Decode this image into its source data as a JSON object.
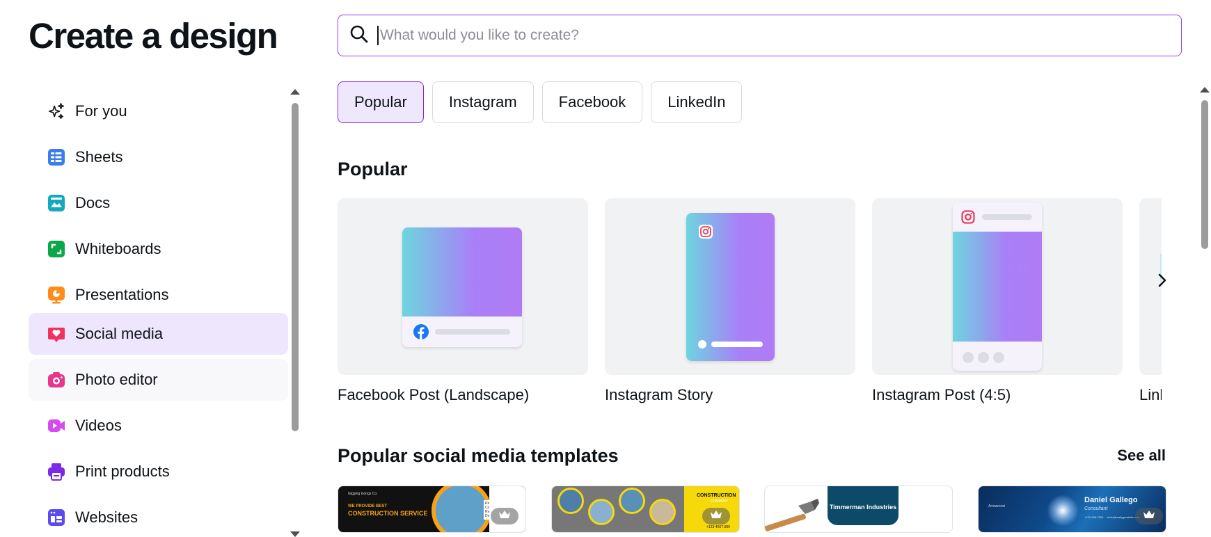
{
  "page": {
    "title": "Create a design"
  },
  "search": {
    "placeholder": "What would you like to create?"
  },
  "sidebar": {
    "items": [
      {
        "label": "For you",
        "icon": "sparkles-icon",
        "color": "#0e1318"
      },
      {
        "label": "Sheets",
        "icon": "sheets-icon",
        "color": "#3b7de9"
      },
      {
        "label": "Docs",
        "icon": "docs-icon",
        "color": "#13a9c1"
      },
      {
        "label": "Whiteboards",
        "icon": "whiteboard-icon",
        "color": "#0ba84a"
      },
      {
        "label": "Presentations",
        "icon": "presentation-icon",
        "color": "#ff8b1a"
      },
      {
        "label": "Social media",
        "icon": "heart-icon",
        "color": "#f0325f",
        "active": true
      },
      {
        "label": "Photo editor",
        "icon": "camera-icon",
        "color": "#e8368f"
      },
      {
        "label": "Videos",
        "icon": "video-icon",
        "color": "#d44cf0"
      },
      {
        "label": "Print products",
        "icon": "printer-icon",
        "color": "#7d2ae8"
      },
      {
        "label": "Websites",
        "icon": "website-icon",
        "color": "#5b4cf0"
      }
    ]
  },
  "chips": [
    {
      "label": "Popular",
      "active": true
    },
    {
      "label": "Instagram"
    },
    {
      "label": "Facebook"
    },
    {
      "label": "LinkedIn"
    }
  ],
  "popular": {
    "title": "Popular",
    "cards": [
      {
        "label": "Facebook Post (Landscape)",
        "icon": "facebook-icon"
      },
      {
        "label": "Instagram Story",
        "icon": "instagram-icon"
      },
      {
        "label": "Instagram Post (4:5)",
        "icon": "instagram-icon"
      },
      {
        "label": "Linl"
      }
    ]
  },
  "templates": {
    "title": "Popular social media templates",
    "see_all": "See all",
    "items": [
      {
        "brand": "Gigging Gongs Co.",
        "kicker": "WE PROVIDE BEST",
        "headline": "CONSTRUCTION SERVICE",
        "bullets": [
          "Renovation",
          "Constructing",
          "Repairing",
          "Decorating"
        ],
        "premium": true
      },
      {
        "headline": "CONSTRUCTION",
        "sub": "COMPANY",
        "phone": "+123-4567-890",
        "premium": true
      },
      {
        "name": "Timmerman Industries"
      },
      {
        "brand": "Arrowcrest",
        "name": "Daniel Gallego",
        "role": "Consultant",
        "phone": "+123-456-7890",
        "email": "hello@reallygreatsite.com",
        "premium": true
      }
    ]
  },
  "colors": {
    "accent": "#8b3dff",
    "active_bg": "#ede6fd",
    "card_bg": "#f1f2f4"
  }
}
